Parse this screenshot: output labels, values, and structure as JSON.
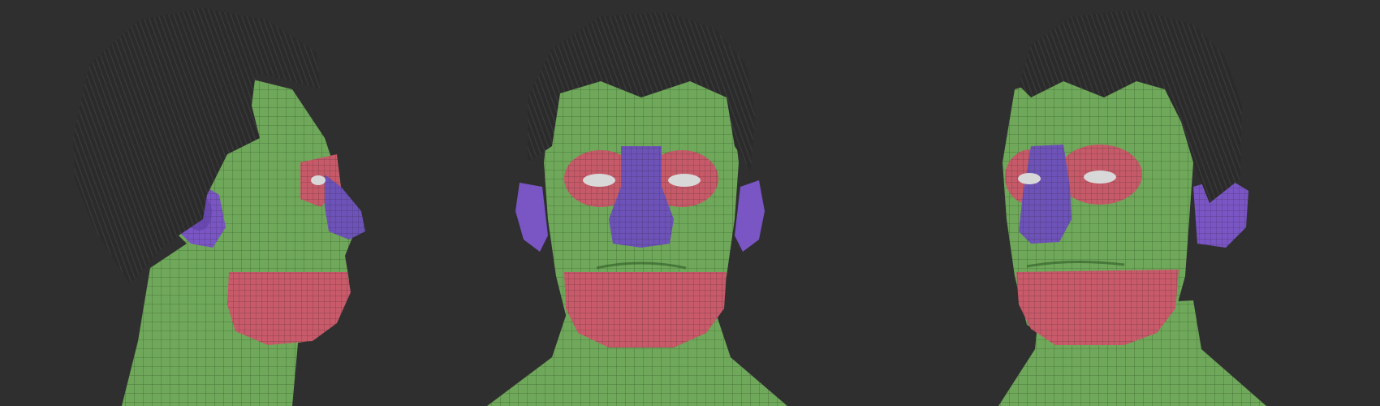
{
  "background_color": "#2f2f2f",
  "polygroup_colors": {
    "skin": "#6fa85a",
    "skin_light": "#8cc270",
    "mouth_jaw": "#c85a6a",
    "eye_ring": "#c65a68",
    "nose": "#6d52b8",
    "ear": "#7a55c4",
    "hair": "#2b2b2b",
    "eyeball": "#d8d8d8"
  },
  "views": [
    {
      "name": "side-view"
    },
    {
      "name": "front-view"
    },
    {
      "name": "three-quarter-view"
    }
  ]
}
